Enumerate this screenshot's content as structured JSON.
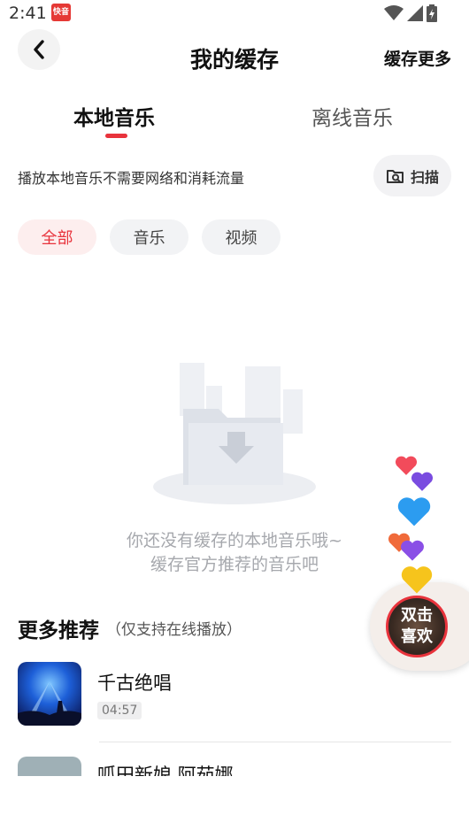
{
  "status_bar": {
    "time": "2:41",
    "app_badge": "快音"
  },
  "header": {
    "title": "我的缓存",
    "more_label": "缓存更多"
  },
  "tabs": [
    {
      "label": "本地音乐",
      "active": true
    },
    {
      "label": "离线音乐",
      "active": false
    }
  ],
  "info": {
    "text": "播放本地音乐不需要网络和消耗流量",
    "scan_label": "扫描"
  },
  "filters": [
    {
      "label": "全部",
      "selected": true
    },
    {
      "label": "音乐",
      "selected": false
    },
    {
      "label": "视频",
      "selected": false
    }
  ],
  "empty_state": {
    "line1": "你还没有缓存的本地音乐哦~",
    "line2": "缓存官方推荐的音乐吧"
  },
  "recommend": {
    "title": "更多推荐",
    "subtitle": "（仅支持在线播放）",
    "songs": [
      {
        "title": "千古绝唱",
        "duration": "04:57"
      },
      {
        "title": "呱田新娘 阿茹娜"
      }
    ]
  },
  "like_button": {
    "line1": "双击",
    "line2": "喜欢"
  },
  "colors": {
    "accent": "#e8333c",
    "chip_selected_bg": "#fdeeee"
  }
}
